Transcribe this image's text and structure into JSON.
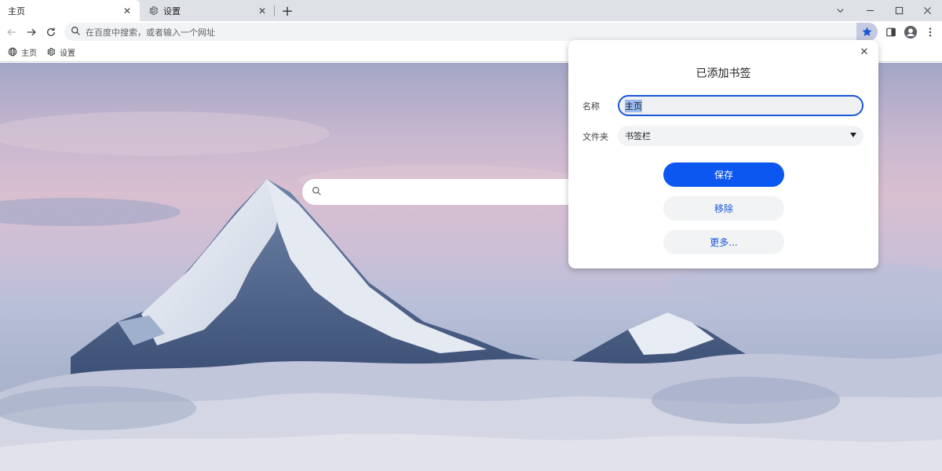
{
  "tabs": [
    {
      "label": "主页",
      "icon": "none",
      "active": true
    },
    {
      "label": "设置",
      "icon": "gear-icon",
      "active": false
    }
  ],
  "window_controls": [
    "chevron-down-icon",
    "minimize-icon",
    "maximize-icon",
    "close-icon"
  ],
  "omnibox": {
    "placeholder": "在百度中搜索，或者输入一个网址"
  },
  "bookmarks_bar": [
    {
      "label": "主页",
      "icon": "globe-icon"
    },
    {
      "label": "设置",
      "icon": "gear-icon"
    }
  ],
  "bubble": {
    "title": "已添加书签",
    "name_label": "名称",
    "name_value": "主页",
    "folder_label": "文件夹",
    "folder_value": "书签栏",
    "save_label": "保存",
    "remove_label": "移除",
    "more_label": "更多..."
  },
  "colors": {
    "accent": "#0b57f0",
    "star": "#1a56d6",
    "star_bg": "#c5cae0",
    "tabstrip": "#dee1e6"
  }
}
